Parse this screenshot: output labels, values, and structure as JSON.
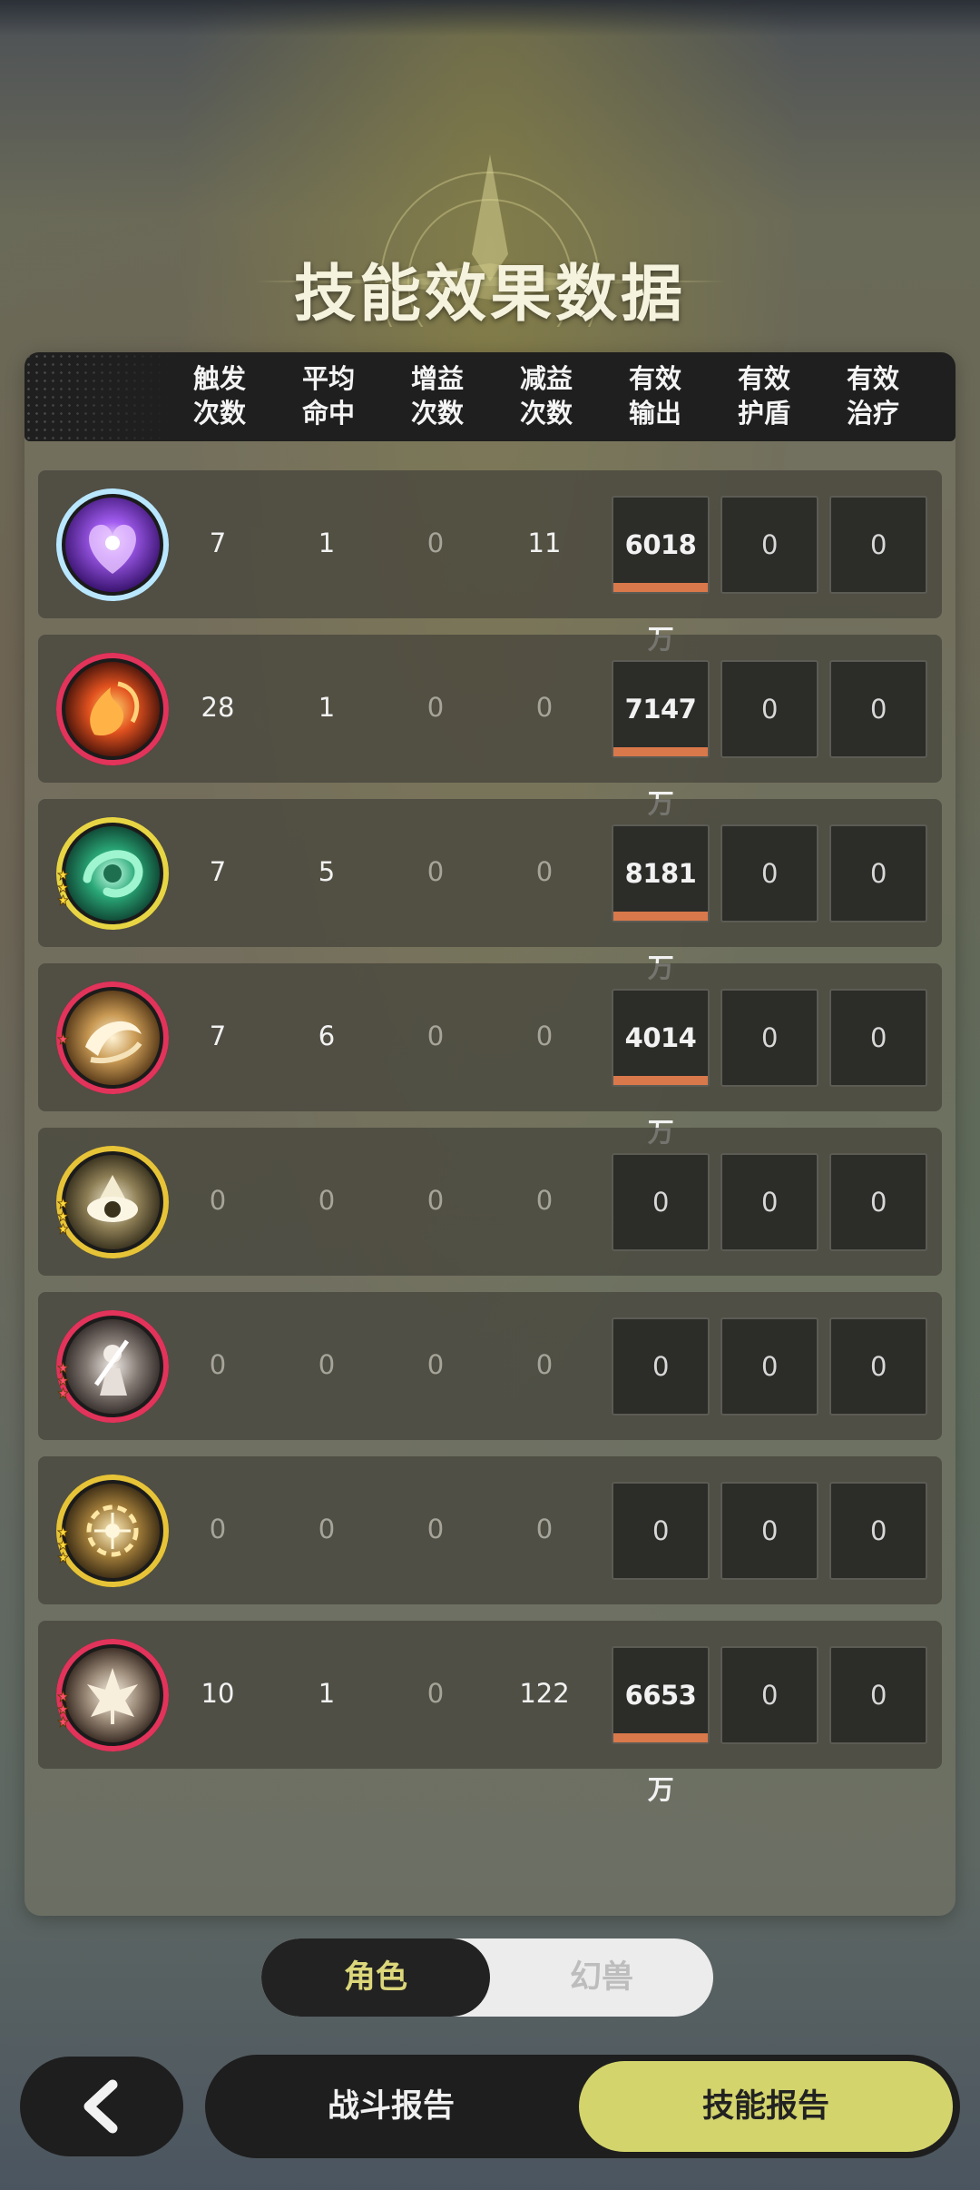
{
  "title": "技能效果数据",
  "header": {
    "columns": [
      {
        "line1": "触发",
        "line2": "次数"
      },
      {
        "line1": "平均",
        "line2": "命中"
      },
      {
        "line1": "增益",
        "line2": "次数"
      },
      {
        "line1": "减益",
        "line2": "次数"
      },
      {
        "line1": "有效",
        "line2": "输出"
      },
      {
        "line1": "有效",
        "line2": "护盾"
      },
      {
        "line1": "有效",
        "line2": "治疗"
      }
    ]
  },
  "rows": [
    {
      "icon": "purple-heart-skill-icon",
      "trigger": "7",
      "avg_hit": "1",
      "buff": "0",
      "debuff": "11",
      "output": "6018万",
      "output_ratio": 1.0,
      "shield": "0",
      "heal": "0"
    },
    {
      "icon": "fire-swirl-skill-icon",
      "trigger": "28",
      "avg_hit": "1",
      "buff": "0",
      "debuff": "0",
      "output": "7147万",
      "output_ratio": 1.0,
      "shield": "0",
      "heal": "0"
    },
    {
      "icon": "green-wind-skill-icon",
      "trigger": "7",
      "avg_hit": "5",
      "buff": "0",
      "debuff": "0",
      "output": "8181万",
      "output_ratio": 1.0,
      "shield": "0",
      "heal": "0"
    },
    {
      "icon": "golden-crescent-skill-icon",
      "trigger": "7",
      "avg_hit": "6",
      "buff": "0",
      "debuff": "0",
      "output": "4014万",
      "output_ratio": 1.0,
      "shield": "0",
      "heal": "0"
    },
    {
      "icon": "eye-skill-icon",
      "trigger": "0",
      "avg_hit": "0",
      "buff": "0",
      "debuff": "0",
      "output": "0",
      "output_ratio": 0,
      "shield": "0",
      "heal": "0"
    },
    {
      "icon": "sword-figure-skill-icon",
      "trigger": "0",
      "avg_hit": "0",
      "buff": "0",
      "debuff": "0",
      "output": "0",
      "output_ratio": 0,
      "shield": "0",
      "heal": "0"
    },
    {
      "icon": "target-vortex-skill-icon",
      "trigger": "0",
      "avg_hit": "0",
      "buff": "0",
      "debuff": "0",
      "output": "0",
      "output_ratio": 0,
      "shield": "0",
      "heal": "0"
    },
    {
      "icon": "leaf-skill-icon",
      "trigger": "10",
      "avg_hit": "1",
      "buff": "0",
      "debuff": "122",
      "output": "6653万",
      "output_ratio": 1.0,
      "shield": "0",
      "heal": "0"
    }
  ],
  "toggle": {
    "active": "角色",
    "inactive": "幻兽"
  },
  "bottom": {
    "back_icon": "chevron-left-icon",
    "battle_report": "战斗报告",
    "skill_report": "技能报告"
  },
  "colors": {
    "accent": "#d3d46c",
    "bar": "#d9784a",
    "toggle_text": "#dcd77a"
  }
}
